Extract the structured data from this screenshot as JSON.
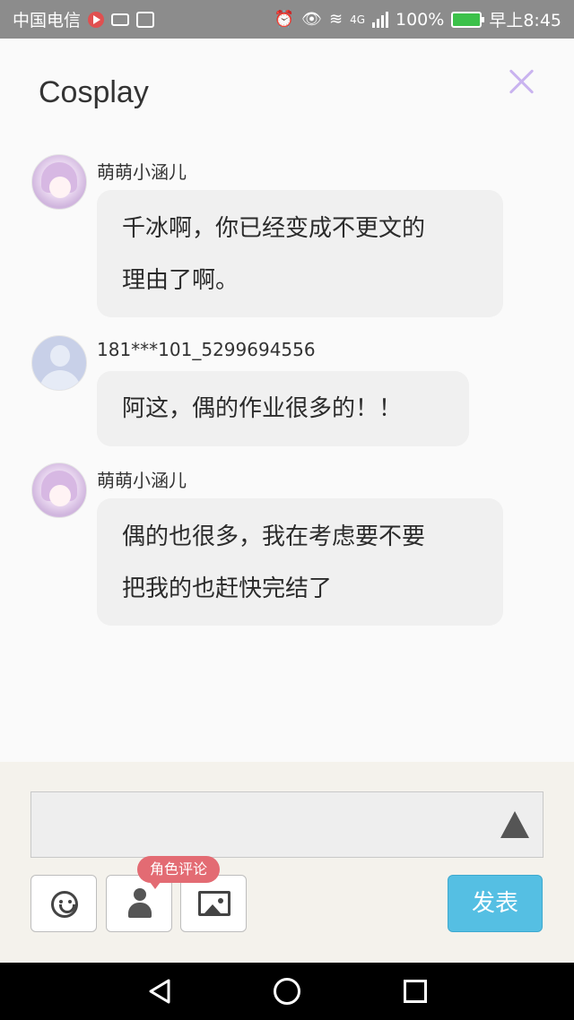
{
  "status_bar": {
    "carrier": "中国电信",
    "battery": "100%",
    "network": "4G",
    "time": "早上8:45"
  },
  "header": {
    "title": "Cosplay"
  },
  "messages": [
    {
      "username": "萌萌小涵儿",
      "avatar": "anime-avatar",
      "lines": [
        "千冰啊，你已经变成不更文的",
        "理由了啊。"
      ]
    },
    {
      "username": "181***101_5299694556",
      "avatar": "default-avatar",
      "lines": [
        "阿这，偶的作业很多的！！"
      ]
    },
    {
      "username": "萌萌小涵儿",
      "avatar": "anime-avatar",
      "lines": [
        "偶的也很多，我在考虑要不要",
        "把我的也赶快完结了"
      ]
    }
  ],
  "composer": {
    "input_value": "",
    "role_tooltip": "角色评论",
    "publish_label": "发表",
    "icons": [
      "smile-icon",
      "person-icon",
      "picture-icon",
      "send-arrow-icon"
    ]
  },
  "colors": {
    "accent_button": "#55bfe3",
    "tooltip": "#e36b73",
    "close_icon": "#c9b3ef",
    "bubble": "#f0f0f0"
  }
}
